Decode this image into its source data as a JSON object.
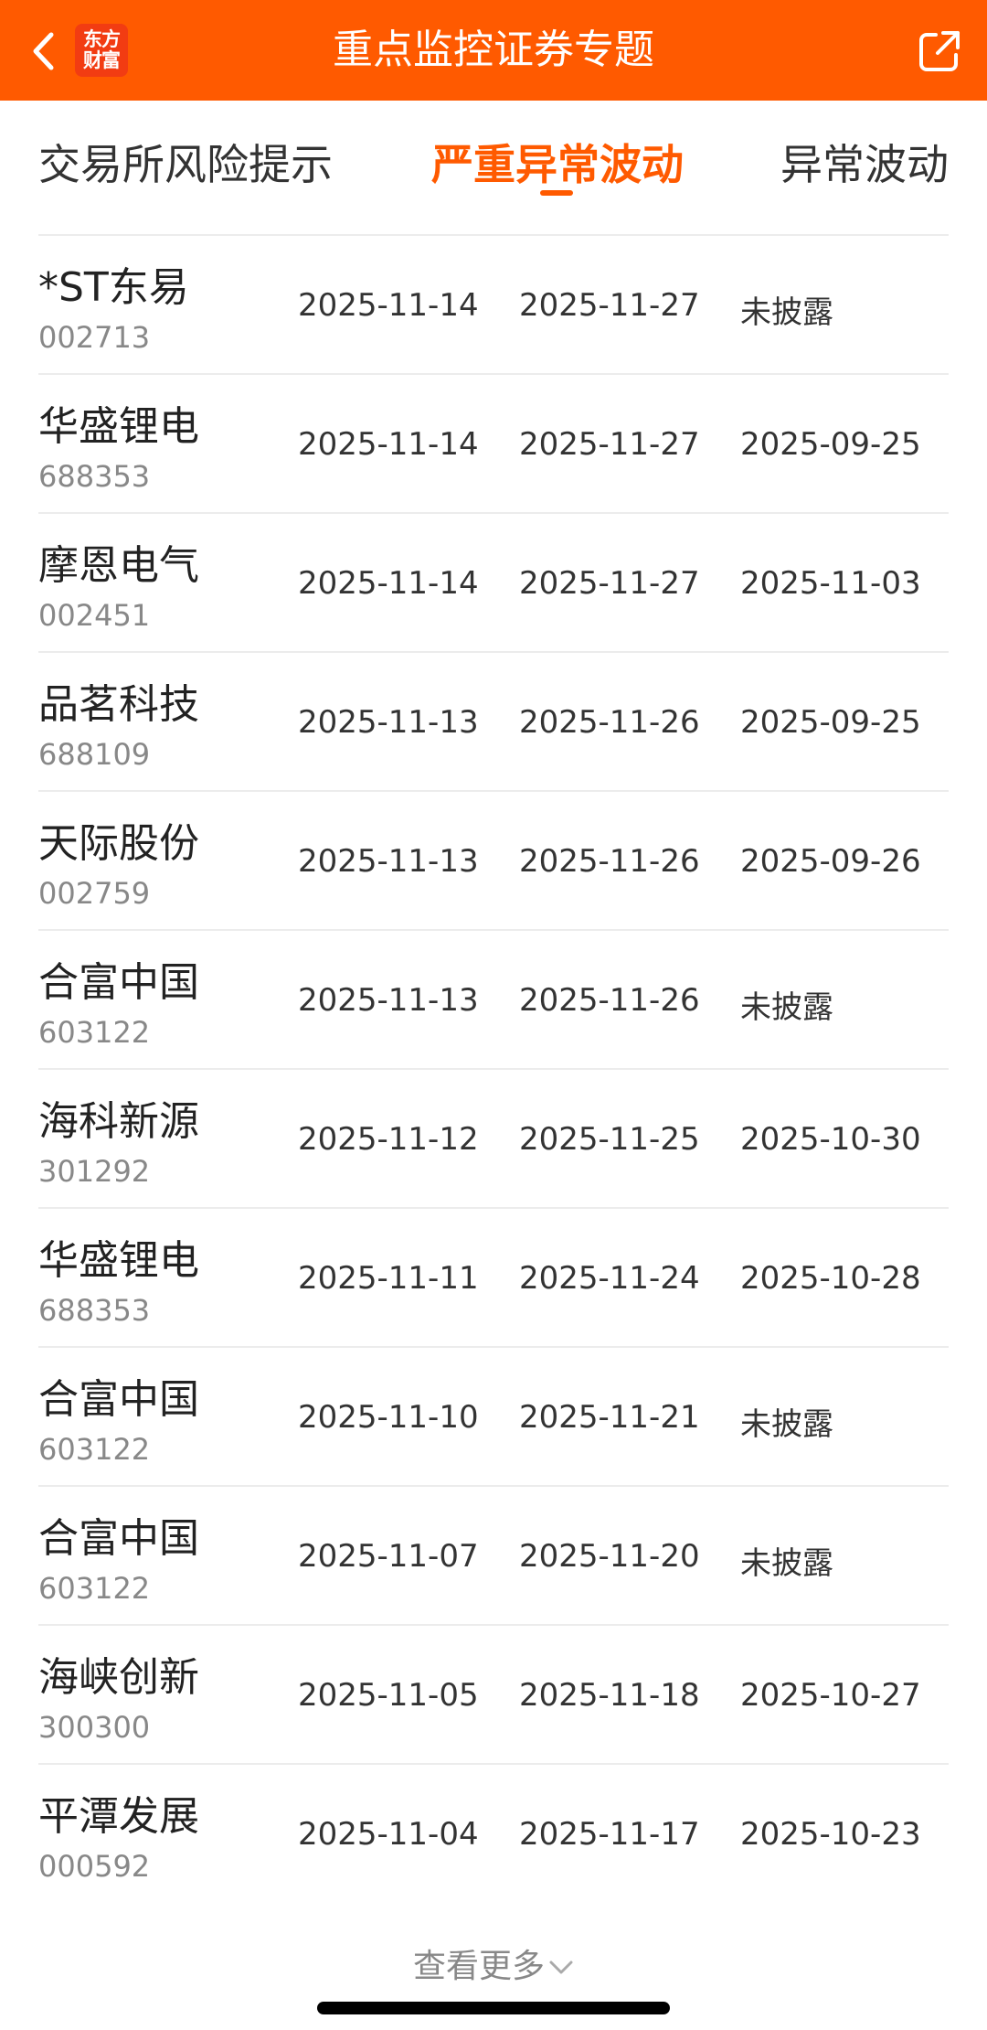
{
  "header": {
    "title": "重点监控证券专题",
    "logo_line1": "东方",
    "logo_line2": "财富",
    "back_icon": "chevron-left-icon",
    "share_icon": "share-icon",
    "background": "#ff5a00"
  },
  "tabs": [
    {
      "label": "交易所风险提示",
      "active": false
    },
    {
      "label": "严重异常波动",
      "active": true
    },
    {
      "label": "异常波动",
      "active": false
    }
  ],
  "rows": [
    {
      "name": "*ST东易",
      "code": "002713",
      "d1": "2025-11-14",
      "d2": "2025-11-27",
      "d3": "未披露"
    },
    {
      "name": "华盛锂电",
      "code": "688353",
      "d1": "2025-11-14",
      "d2": "2025-11-27",
      "d3": "2025-09-25"
    },
    {
      "name": "摩恩电气",
      "code": "002451",
      "d1": "2025-11-14",
      "d2": "2025-11-27",
      "d3": "2025-11-03"
    },
    {
      "name": "品茗科技",
      "code": "688109",
      "d1": "2025-11-13",
      "d2": "2025-11-26",
      "d3": "2025-09-25"
    },
    {
      "name": "天际股份",
      "code": "002759",
      "d1": "2025-11-13",
      "d2": "2025-11-26",
      "d3": "2025-09-26"
    },
    {
      "name": "合富中国",
      "code": "603122",
      "d1": "2025-11-13",
      "d2": "2025-11-26",
      "d3": "未披露"
    },
    {
      "name": "海科新源",
      "code": "301292",
      "d1": "2025-11-12",
      "d2": "2025-11-25",
      "d3": "2025-10-30"
    },
    {
      "name": "华盛锂电",
      "code": "688353",
      "d1": "2025-11-11",
      "d2": "2025-11-24",
      "d3": "2025-10-28"
    },
    {
      "name": "合富中国",
      "code": "603122",
      "d1": "2025-11-10",
      "d2": "2025-11-21",
      "d3": "未披露"
    },
    {
      "name": "合富中国",
      "code": "603122",
      "d1": "2025-11-07",
      "d2": "2025-11-20",
      "d3": "未披露"
    },
    {
      "name": "海峡创新",
      "code": "300300",
      "d1": "2025-11-05",
      "d2": "2025-11-18",
      "d3": "2025-10-27"
    },
    {
      "name": "平潭发展",
      "code": "000592",
      "d1": "2025-11-04",
      "d2": "2025-11-17",
      "d3": "2025-10-23"
    }
  ],
  "footer": {
    "more_label": "查看更多",
    "more_icon": "chevron-down-icon"
  }
}
